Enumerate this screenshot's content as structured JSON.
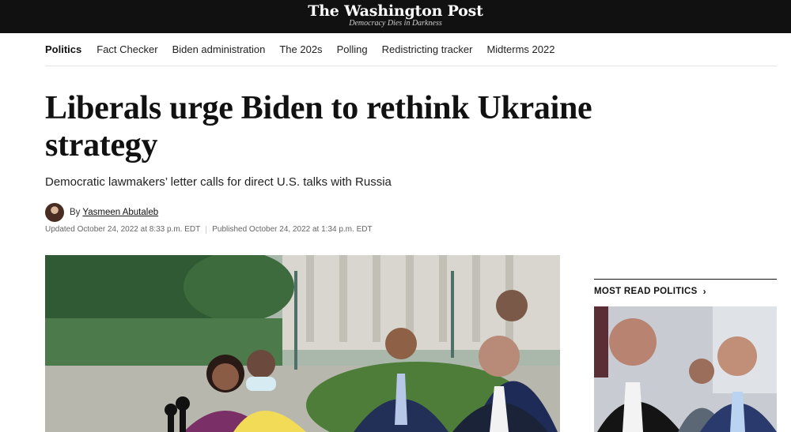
{
  "masthead": {
    "logo_text": "The Washington Post",
    "tagline": "Democracy Dies in Darkness"
  },
  "nav": {
    "items": [
      {
        "label": "Politics",
        "active": true
      },
      {
        "label": "Fact Checker"
      },
      {
        "label": "Biden administration"
      },
      {
        "label": "The 202s"
      },
      {
        "label": "Polling"
      },
      {
        "label": "Redistricting tracker"
      },
      {
        "label": "Midterms 2022"
      }
    ]
  },
  "article": {
    "headline": "Liberals urge Biden to rethink Ukraine strategy",
    "subheadline": "Democratic lawmakers’ letter calls for direct U.S. talks with Russia",
    "byline_prefix": "By",
    "author": "Yasmeen Abutaleb",
    "updated": "Updated October 24, 2022 at 8:33 p.m. EDT",
    "published": "Published October 24, 2022 at 1:34 p.m. EDT"
  },
  "rail": {
    "title": "MOST READ POLITICS",
    "chevron": "›"
  },
  "icons": {
    "author_avatar": "author-avatar-photo",
    "rail_chevron": "chevron-right-icon"
  }
}
